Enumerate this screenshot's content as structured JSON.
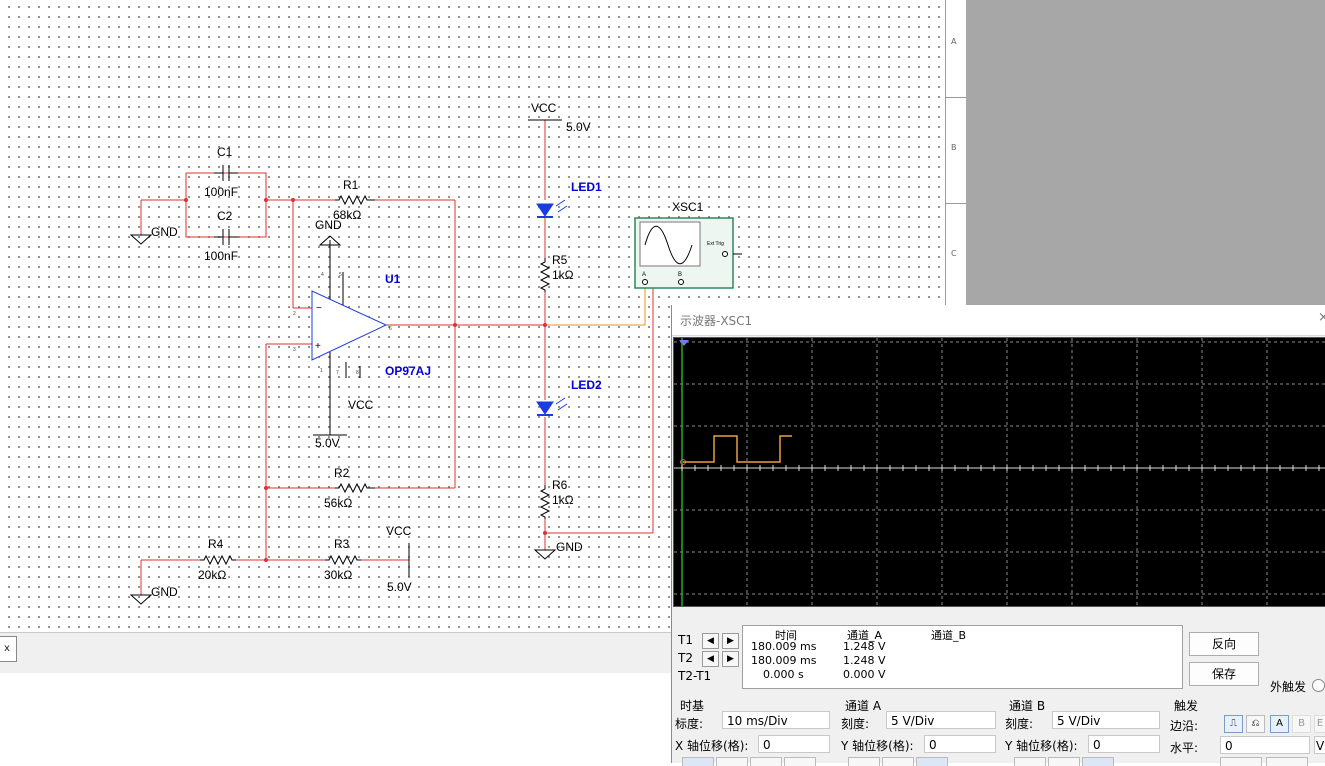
{
  "schematic": {
    "components": {
      "c1": {
        "ref": "C1",
        "value": "100nF"
      },
      "c2": {
        "ref": "C2",
        "value": "100nF"
      },
      "r1": {
        "ref": "R1",
        "value": "68kΩ"
      },
      "r2": {
        "ref": "R2",
        "value": "56kΩ"
      },
      "r3": {
        "ref": "R3",
        "value": "30kΩ"
      },
      "r4": {
        "ref": "R4",
        "value": "20kΩ"
      },
      "r5": {
        "ref": "R5",
        "value": "1kΩ"
      },
      "r6": {
        "ref": "R6",
        "value": "1kΩ"
      },
      "u1": {
        "ref": "U1",
        "value": "OP97AJ"
      },
      "led1": {
        "ref": "LED1"
      },
      "led2": {
        "ref": "LED2"
      },
      "xsc1": {
        "ref": "XSC1",
        "a_label": "A",
        "b_label": "B",
        "ext_trig": "Ext Trig"
      }
    },
    "power": {
      "vcc": "VCC",
      "gnd": "GND",
      "voltage": "5.0V"
    },
    "pins": {
      "p4": "4",
      "p5": "5",
      "p2": "2",
      "p3": "3",
      "p6": "6",
      "p1": "1",
      "p7": "7",
      "p8": "8"
    },
    "border_letters": [
      "A",
      "B",
      "C"
    ],
    "tab_label": "x"
  },
  "oscilloscope": {
    "title": "示波器-XSC1",
    "close": "×",
    "readout": {
      "headers": {
        "time": "时间",
        "ch_a": "通道_A",
        "ch_b": "通道_B"
      },
      "labels": {
        "t1": "T1",
        "t2": "T2",
        "diff": "T2-T1"
      },
      "rows": [
        {
          "time": "180.009 ms",
          "a": "1.248 V",
          "b": ""
        },
        {
          "time": "180.009 ms",
          "a": "1.248 V",
          "b": ""
        },
        {
          "time": "0.000 s",
          "a": "0.000 V",
          "b": ""
        }
      ]
    },
    "buttons": {
      "reverse": "反向",
      "save": "保存"
    },
    "ext_trigger": "外触发",
    "timebase": {
      "section": "时基",
      "scale_label": "标度:",
      "scale": "10 ms/Div",
      "xpos_label": "X 轴位移(格):",
      "xpos": "0"
    },
    "channel_a": {
      "section": "通道 A",
      "scale_label": "刻度:",
      "scale": "5  V/Div",
      "ypos_label": "Y 轴位移(格):",
      "ypos": "0"
    },
    "channel_b": {
      "section": "通道 B",
      "scale_label": "刻度:",
      "scale": "5  V/Div",
      "ypos_label": "Y 轴位移(格):",
      "ypos": "0"
    },
    "trigger": {
      "section": "触发",
      "edge_label": "边沿:",
      "level_label": "水平:",
      "level": "0",
      "source_a": "A",
      "source_b": "B",
      "source_ext": "E"
    },
    "waveform": {
      "baseline_div": 0,
      "high_level": 1.248
    }
  }
}
